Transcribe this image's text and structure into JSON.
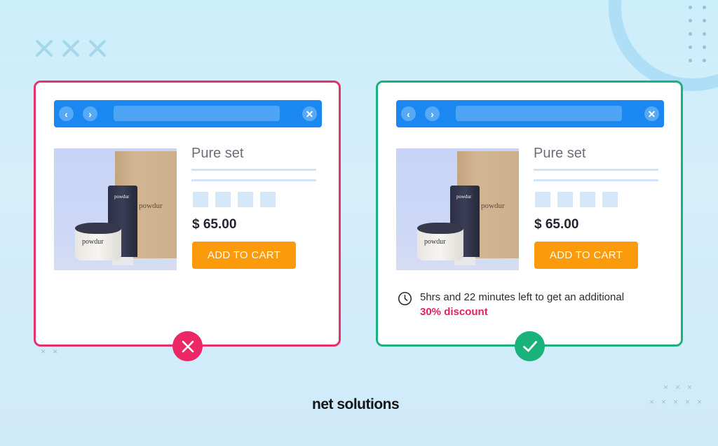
{
  "comparison": {
    "bad_example": {
      "browser": {
        "back_icon": "chevron-left",
        "forward_icon": "chevron-right",
        "close_icon": "x"
      },
      "product": {
        "image_brand_text": "powdur",
        "title": "Pure set",
        "price": "$ 65.00",
        "cta_label": "ADD TO CART",
        "swatch_count": 4
      },
      "verdict_icon": "cross",
      "colors": {
        "border": "#e3326c",
        "badge": "#ec2766"
      }
    },
    "good_example": {
      "browser": {
        "back_icon": "chevron-left",
        "forward_icon": "chevron-right",
        "close_icon": "x"
      },
      "product": {
        "image_brand_text": "powdur",
        "title": "Pure set",
        "price": "$ 65.00",
        "cta_label": "ADD TO CART",
        "swatch_count": 4
      },
      "urgency": {
        "icon": "clock",
        "text": "5hrs and 22 minutes left to get an additional",
        "highlight": "30% discount"
      },
      "verdict_icon": "checkmark",
      "colors": {
        "border": "#1ab17f",
        "badge": "#18b27a"
      }
    }
  },
  "brand": {
    "logo_text_part1": "net s",
    "logo_text_o": "o",
    "logo_text_part2": "lutions"
  },
  "colors": {
    "browser_bar": "#1a88f0",
    "cta": "#fb9b0c",
    "highlight": "#e1245f",
    "background": "#cdeefb"
  }
}
